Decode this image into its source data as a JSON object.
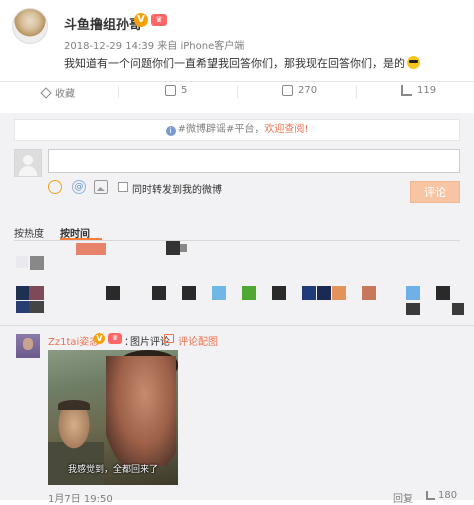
{
  "post": {
    "author": "斗鱼撸组孙哥",
    "verified_badge": "V",
    "level_badge": "",
    "meta": "2018-12-29 14:39 来自 iPhone客户端",
    "text": "我知道有一个问题你们一直希望我回答你们，那我现在回答你们，是的"
  },
  "actions": {
    "favorite": "收藏",
    "share": "5",
    "comment": "270",
    "like": "119"
  },
  "comments": {
    "notice": {
      "prefix": "#微博辟谣#平台，",
      "highlight": "欢迎查阅!"
    },
    "composer": {
      "input_placeholder": "",
      "repost_label": "同时转发到我的微博",
      "submit_label": "评论"
    },
    "tabs": {
      "hot": "按热度",
      "time": "按时间"
    },
    "items": [
      {
        "name": "Zz1tai姿态",
        "verified": "V",
        "colon": "：",
        "text": "图片评论",
        "image_link": "评论配图",
        "image_caption": "我感觉到，全都回来了",
        "time": "1月7日 19:50",
        "reply": "回复",
        "likes": "180"
      }
    ]
  },
  "colors": {
    "accent": "#eb7350",
    "vip": "#f7a10a",
    "background": "#f2f2f5"
  }
}
